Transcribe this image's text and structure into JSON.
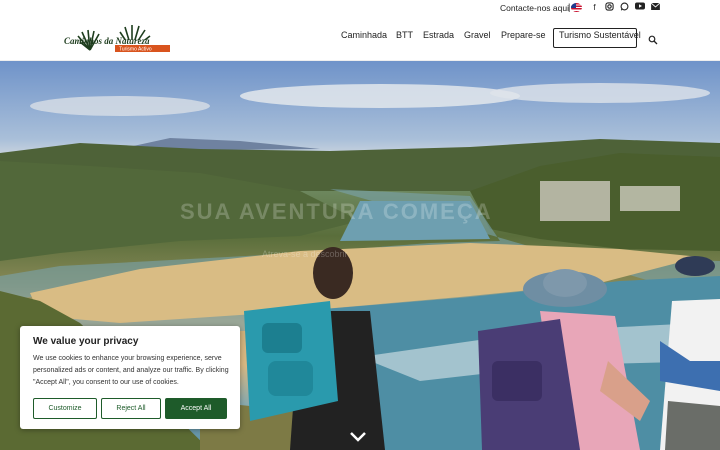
{
  "topbar": {
    "contact_label": "Contacte-nos aqui",
    "separator": "|",
    "flag_icon": "us-flag-icon",
    "social_icons": [
      "facebook-icon",
      "instagram-icon",
      "whatsapp-icon",
      "youtube-icon",
      "mail-icon"
    ]
  },
  "header": {
    "logo_text": "Caminhos da Natureza",
    "logo_subtitle": "Turismo Activo",
    "nav": [
      "Caminhada",
      "BTT",
      "Estrada",
      "Gravel",
      "Prepare-se",
      "Turismo Sustentável"
    ],
    "search_icon": "search-icon"
  },
  "hero": {
    "faded_title": "SUA AVENTURA COMEÇA",
    "faded_subtitle": "Atreva-se a descobrir",
    "chevron_icon": "chevron-down-icon"
  },
  "cookie": {
    "title": "We value your privacy",
    "text": "We use cookies to enhance your browsing experience, serve personalized ads or content, and analyze our traffic. By clicking \"Accept All\", you consent to our use of cookies.",
    "customize": "Customize",
    "reject": "Reject All",
    "accept": "Accept All"
  },
  "colors": {
    "accent_green": "#1e5b2a",
    "logo_orange": "#d9541e"
  }
}
